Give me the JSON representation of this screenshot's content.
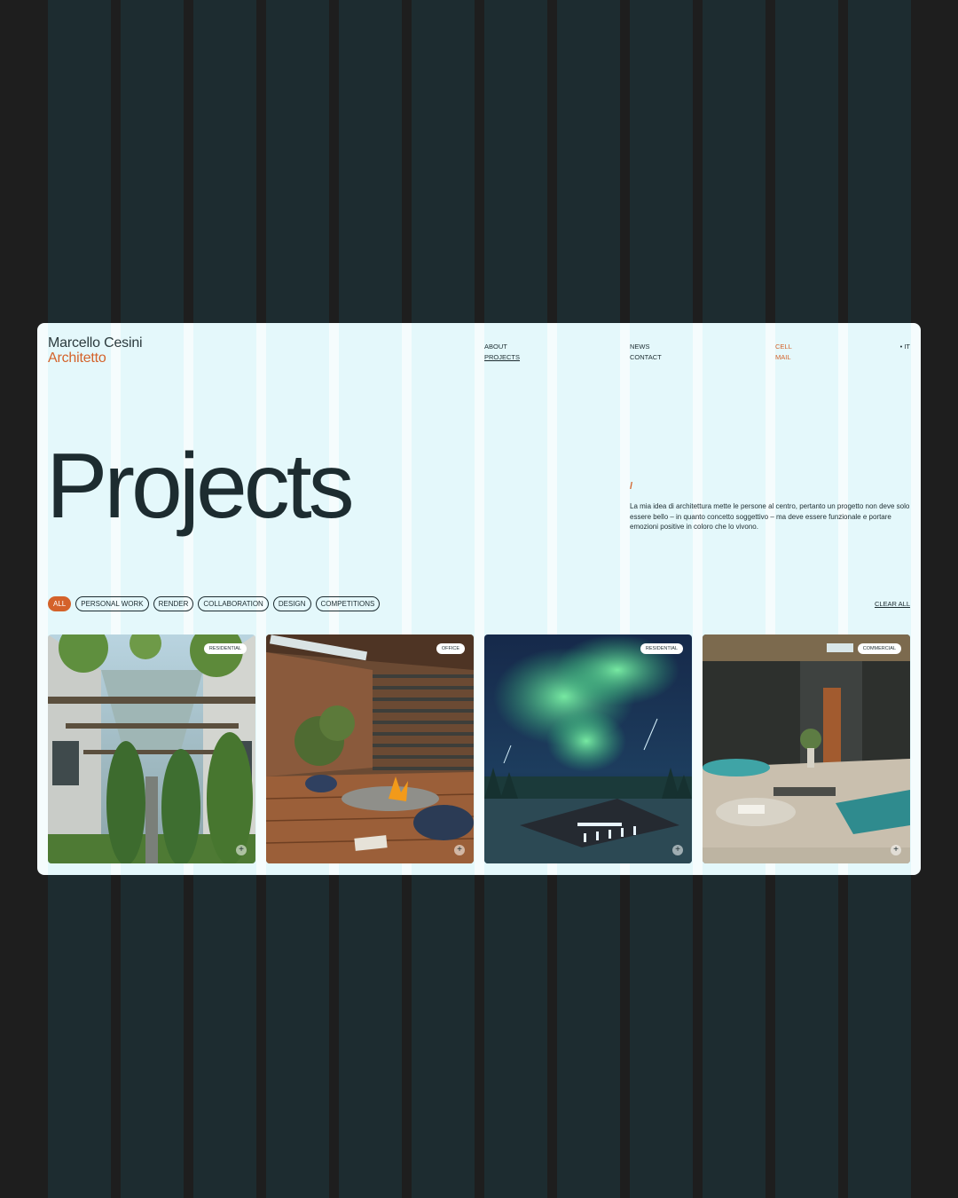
{
  "brand": {
    "name": "Marcello Cesini",
    "role": "Architetto"
  },
  "nav": {
    "col1": [
      "ABOUT",
      "PROJECTS"
    ],
    "col2": [
      "NEWS",
      "CONTACT"
    ],
    "col3": [
      "CELL",
      "MAIL"
    ],
    "lang": "• IT",
    "active": "PROJECTS"
  },
  "hero": {
    "title": "Projects",
    "slash": "/",
    "intro": "La mia idea di architettura mette le persone al centro, pertanto un progetto non deve solo essere bello – in quanto concetto soggettivo – ma deve essere funzionale e portare emozioni positive in coloro che lo vivono."
  },
  "filters": {
    "items": [
      "ALL",
      "PERSONAL WORK",
      "RENDER",
      "COLLABORATION",
      "DESIGN",
      "COMPETITIONS"
    ],
    "active": "ALL",
    "clear": "CLEAR ALL"
  },
  "projects": [
    {
      "tag": "RESIDENTIAL",
      "image": "courtyard-with-cypress-trees",
      "action_icon": "plus-icon"
    },
    {
      "tag": "OFFICE",
      "image": "wooden-terrace-with-firepit",
      "action_icon": "plus-icon"
    },
    {
      "tag": "RESIDENTIAL",
      "image": "northern-lights-over-house",
      "action_icon": "plus-icon"
    },
    {
      "tag": "COMMERCIAL",
      "image": "spa-interior-with-pool",
      "action_icon": "plus-icon"
    }
  ],
  "colors": {
    "backdrop": "#1e1e1e",
    "column": "#1d2c30",
    "page": "#f5fcfd",
    "grid": "#e4f8fb",
    "accent": "#d4622a",
    "text": "#1d2c30"
  }
}
